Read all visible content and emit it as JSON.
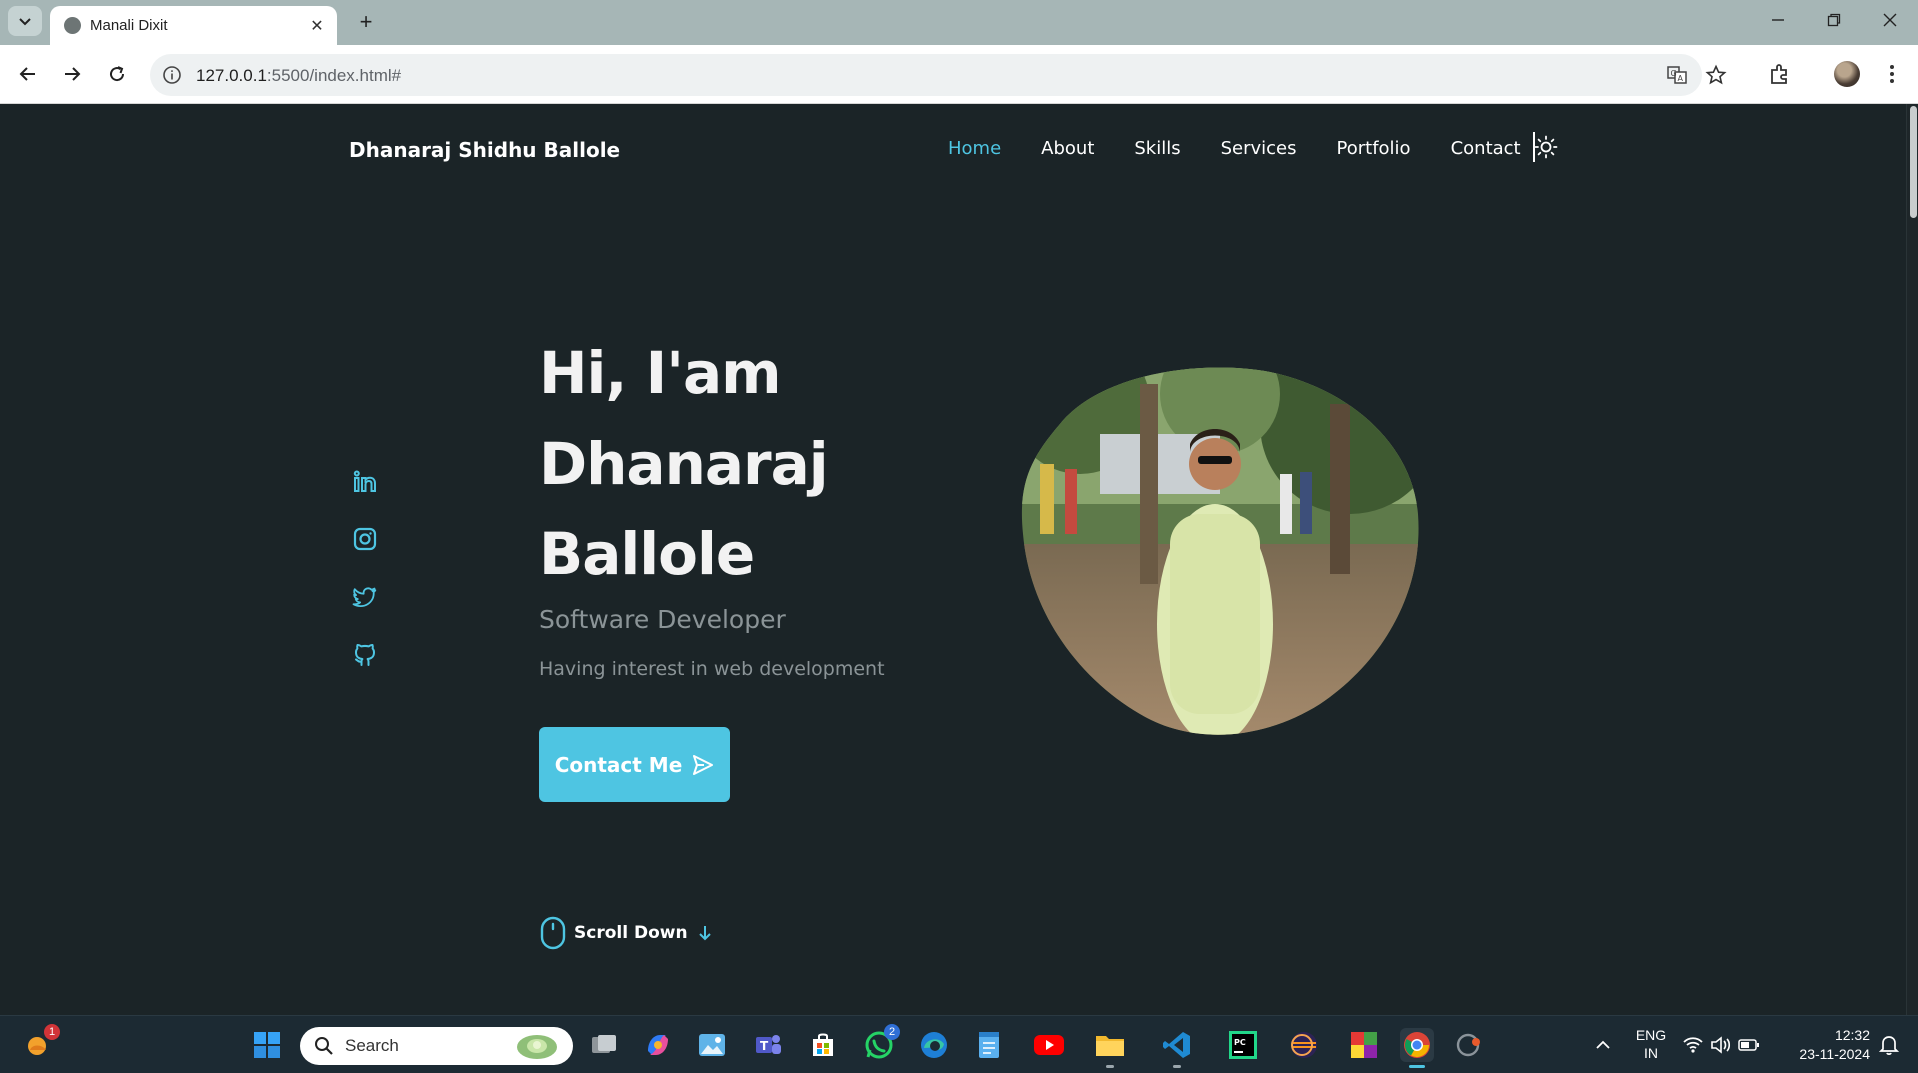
{
  "browser": {
    "tab_title": "Manali Dixit",
    "url_host": "127.0.0.1",
    "url_rest": ":5500/index.html#"
  },
  "site": {
    "logo": "Dhanaraj Shidhu Ballole",
    "nav": [
      "Home",
      "About",
      "Skills",
      "Services",
      "Portfolio",
      "Contact"
    ],
    "active_nav": "Home",
    "accent_color": "#4ec5e2",
    "background_color": "#1b2427"
  },
  "hero": {
    "title_lines": [
      "Hi, I'am",
      "Dhanaraj",
      "Ballole"
    ],
    "subtitle": "Software Developer",
    "description": "Having interest in web development",
    "button_label": "Contact Me",
    "social_icons": [
      "linkedin-icon",
      "instagram-icon",
      "twitter-icon",
      "github-icon"
    ]
  },
  "scroll_down": {
    "label": "Scroll Down"
  },
  "taskbar": {
    "search_placeholder": "Search",
    "widget_badge": "1",
    "whatsapp_badge": "2",
    "lang_line1": "ENG",
    "lang_line2": "IN",
    "time": "12:32",
    "date": "23-11-2024"
  }
}
